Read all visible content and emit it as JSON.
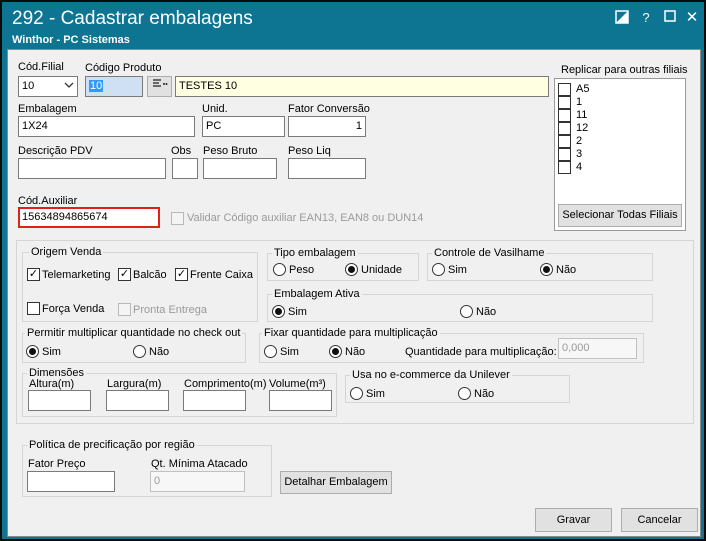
{
  "window": {
    "title": "292 - Cadastrar embalagens",
    "subtitle": "Winthor - PC Sistemas"
  },
  "form": {
    "cod_filial_label": "Cód.Filial",
    "cod_filial_value": "10",
    "codigo_produto_label": "Código Produto",
    "codigo_produto_value": "10",
    "produto_descricao": "TESTES 10",
    "embalagem_label": "Embalagem",
    "embalagem_value": "1X24",
    "unid_label": "Unid.",
    "unid_value": "PC",
    "fator_conversao_label": "Fator Conversão",
    "fator_conversao_value": "1",
    "descricao_pdv_label": "Descrição PDV",
    "obs_label": "Obs",
    "peso_bruto_label": "Peso Bruto",
    "peso_liq_label": "Peso Liq",
    "cod_auxiliar_label": "Cód.Auxiliar",
    "cod_auxiliar_value": "15634894865674",
    "validar_label": "Validar Código auxiliar EAN13, EAN8 ou DUN14"
  },
  "replicar": {
    "label": "Replicar para outras filiais",
    "filiais": [
      "A5",
      "1",
      "11",
      "12",
      "2",
      "3",
      "4"
    ],
    "button": "Selecionar Todas Filiais"
  },
  "origem_venda": {
    "label": "Origem Venda",
    "telemarketing": "Telemarketing",
    "balcao": "Balcão",
    "frente_caixa": "Frente Caixa",
    "forca_venda": "Força Venda",
    "pronta_entrega": "Pronta Entrega"
  },
  "tipo_embalagem": {
    "label": "Tipo embalagem",
    "peso": "Peso",
    "unidade": "Unidade"
  },
  "controle_vasilhame": {
    "label": "Controle de Vasilhame",
    "sim": "Sim",
    "nao": "Não"
  },
  "embalagem_ativa": {
    "label": "Embalagem Ativa",
    "sim": "Sim",
    "nao": "Não"
  },
  "permitir_multiplicar": {
    "label": "Permitir multiplicar quantidade no check out",
    "sim": "Sim",
    "nao": "Não"
  },
  "fixar_quantidade": {
    "label": "Fixar quantidade para multiplicação",
    "sim": "Sim",
    "nao": "Não",
    "qtd_label": "Quantidade para multiplicação:",
    "qtd_value": "0,000"
  },
  "dimensoes": {
    "label": "Dimensões",
    "altura": "Altura(m)",
    "largura": "Largura(m)",
    "comprimento": "Comprimento(m)",
    "volume": "Volume(m³)"
  },
  "unilever": {
    "label": "Usa no e-commerce da Unilever",
    "sim": "Sim",
    "nao": "Não"
  },
  "precificacao": {
    "label": "Política de precificação por região",
    "fator_preco": "Fator Preço",
    "qt_minima": "Qt. Mínima Atacado",
    "qt_minima_value": "0"
  },
  "buttons": {
    "detalhar": "Detalhar Embalagem",
    "gravar": "Gravar",
    "cancelar": "Cancelar"
  }
}
